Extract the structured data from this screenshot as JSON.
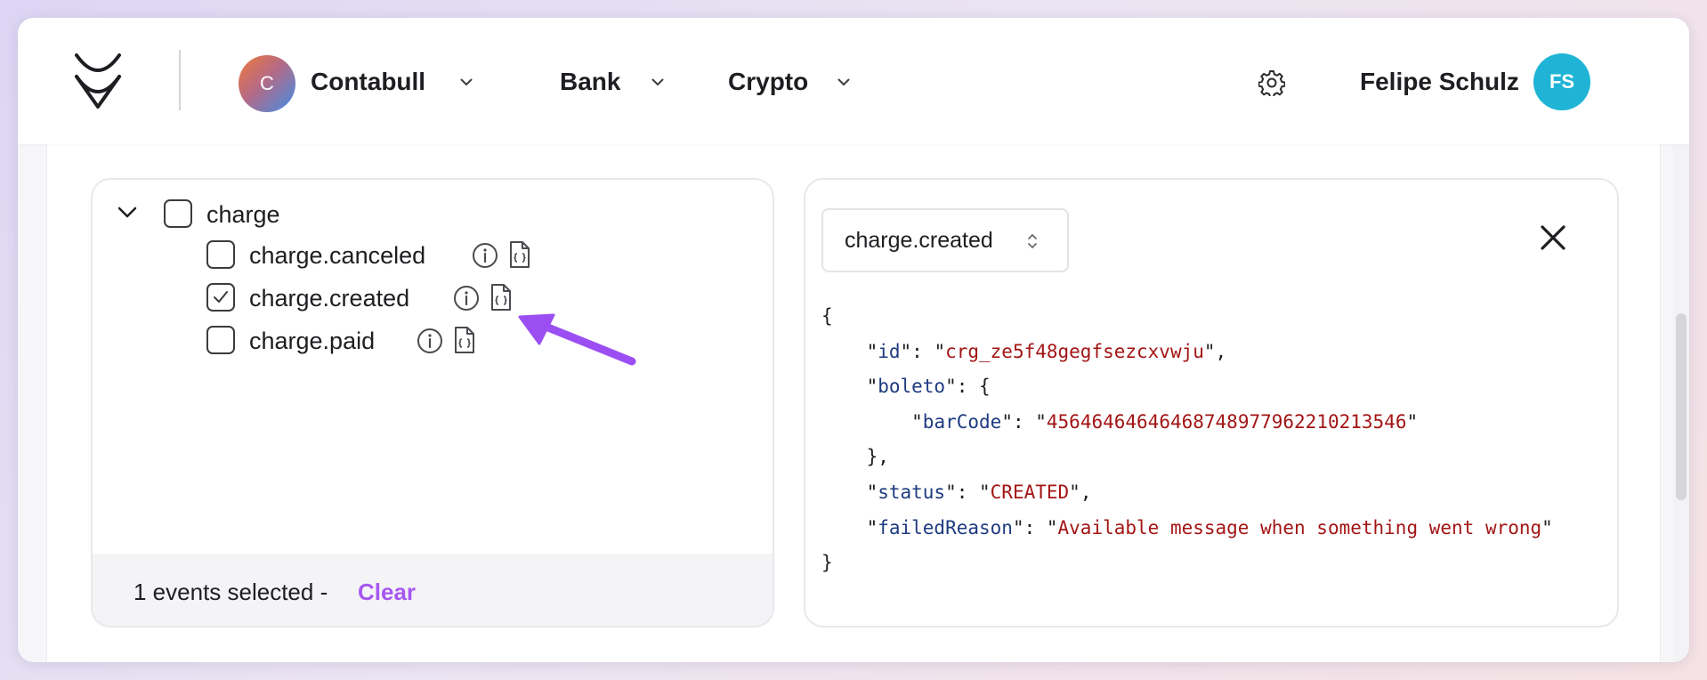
{
  "header": {
    "org": {
      "initial": "C",
      "name": "Contabull"
    },
    "nav": [
      {
        "label": "Bank"
      },
      {
        "label": "Crypto"
      }
    ],
    "user": {
      "name": "Felipe Schulz",
      "initials": "FS"
    }
  },
  "events": {
    "group": {
      "label": "charge",
      "checked": false,
      "expanded": true
    },
    "items": [
      {
        "label": "charge.canceled",
        "checked": false
      },
      {
        "label": "charge.created",
        "checked": true
      },
      {
        "label": "charge.paid",
        "checked": false
      }
    ],
    "footer": {
      "summary": "1 events selected - ",
      "clear_label": "Clear"
    }
  },
  "preview": {
    "selected_event": "charge.created",
    "json": {
      "id": "crg_ze5f48gegfsezcxvwju",
      "boleto": {
        "barCode": "45646464646468748977962210213546"
      },
      "status": "CREATED",
      "failedReason": "Available message when something went wrong"
    }
  },
  "colors": {
    "accent": "#a757f0",
    "avatar_user": "#1fb4d6",
    "json_key": "#1e3b80",
    "json_string": "#a31515"
  }
}
